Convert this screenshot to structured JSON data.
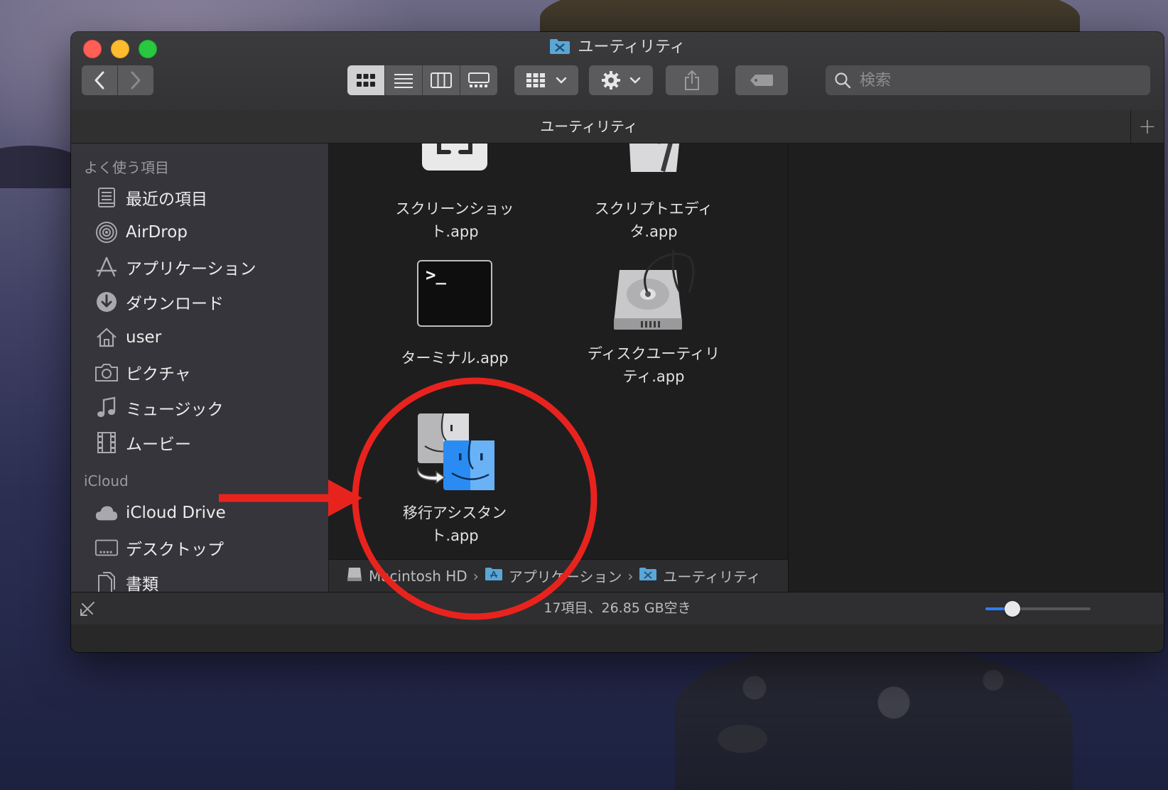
{
  "window": {
    "title": "ユーティリティ",
    "tab_title": "ユーティリティ",
    "tab_add": "+",
    "search_placeholder": "検索"
  },
  "sidebar": {
    "favorites_header": "よく使う項目",
    "favorites": [
      {
        "label": "最近の項目",
        "icon": "recents-icon"
      },
      {
        "label": "AirDrop",
        "icon": "airdrop-icon"
      },
      {
        "label": "アプリケーション",
        "icon": "applications-icon"
      },
      {
        "label": "ダウンロード",
        "icon": "downloads-icon"
      },
      {
        "label": "user",
        "icon": "home-icon"
      },
      {
        "label": "ピクチャ",
        "icon": "camera-icon"
      },
      {
        "label": "ミュージック",
        "icon": "music-icon"
      },
      {
        "label": "ムービー",
        "icon": "film-icon"
      }
    ],
    "icloud_header": "iCloud",
    "icloud": [
      {
        "label": "iCloud Drive",
        "icon": "cloud-icon"
      },
      {
        "label": "デスクトップ",
        "icon": "desktop-icon"
      },
      {
        "label": "書類",
        "icon": "document-icon"
      }
    ]
  },
  "files": [
    {
      "line1": "スクリーンショッ",
      "line2": "ト.app",
      "icon": "screenshot-app-icon"
    },
    {
      "line1": "スクリプトエディ",
      "line2": "タ.app",
      "icon": "script-editor-app-icon"
    },
    {
      "line1": "ターミナル.app",
      "line2": "",
      "icon": "terminal-app-icon"
    },
    {
      "line1": "ディスクユーティリ",
      "line2": "ティ.app",
      "icon": "disk-utility-app-icon"
    },
    {
      "line1": "移行アシスタン",
      "line2": "ト.app",
      "icon": "migration-assistant-app-icon"
    }
  ],
  "terminal_prompt": ">_",
  "path_bar": {
    "items": [
      "Macintosh HD",
      "アプリケーション",
      "ユーティリティ"
    ],
    "separator": "›"
  },
  "status": {
    "text": "17項目、26.85 GB空き",
    "zoom_fraction": 0.26
  },
  "colors": {
    "annotation_red": "#e8231e",
    "accent_blue": "#2f7cf6",
    "close": "#ff5f57",
    "minimize": "#febc2e",
    "maximize": "#28c840"
  }
}
